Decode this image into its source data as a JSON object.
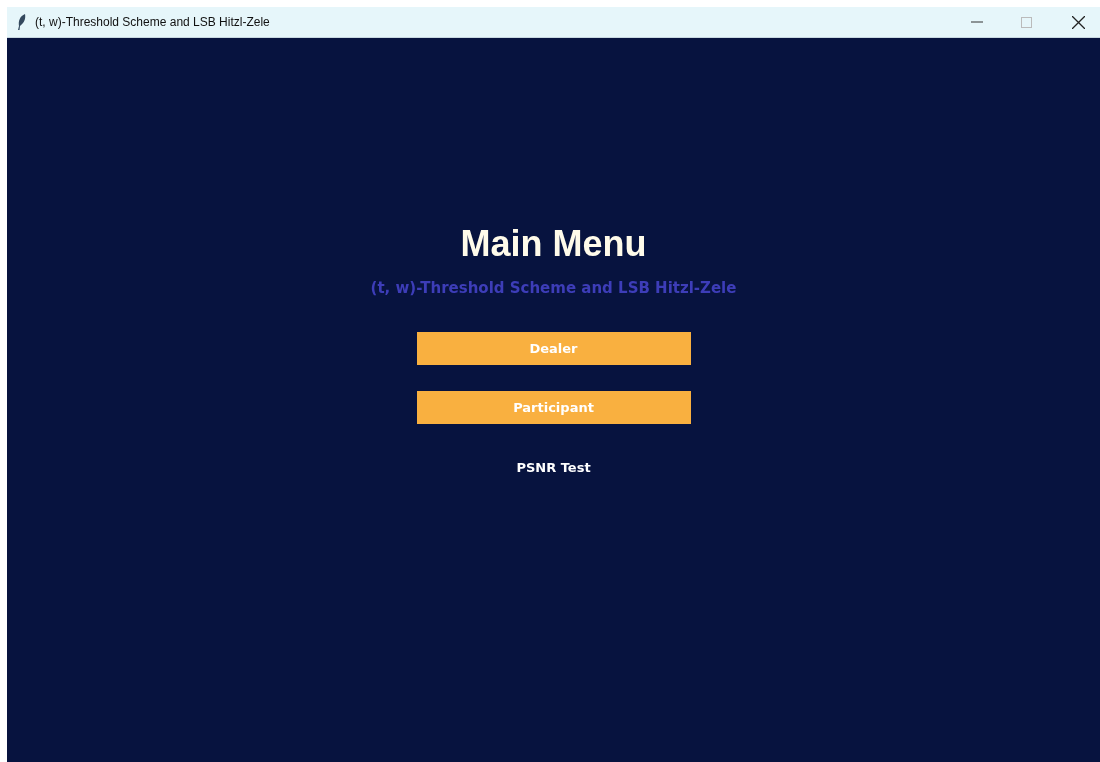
{
  "window": {
    "title": "(t, w)-Threshold Scheme and LSB Hitzl-Zele"
  },
  "main": {
    "heading": "Main Menu",
    "subtitle": "(t, w)-Threshold Scheme and LSB Hitzl-Zele",
    "buttons": [
      {
        "label": "Dealer",
        "kind": "filled"
      },
      {
        "label": "Participant",
        "kind": "filled"
      },
      {
        "label": "PSNR Test",
        "kind": "flat"
      }
    ]
  }
}
